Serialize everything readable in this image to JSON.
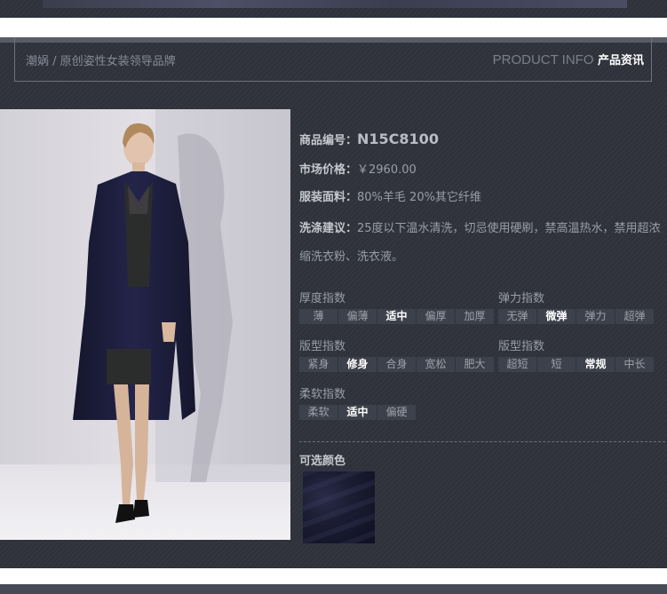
{
  "header": {
    "breadcrumb": "潮娲 / 原创姿性女装领导品牌",
    "section_en": "PRODUCT INFO",
    "section_cn": "产品资讯"
  },
  "product": {
    "code_label": "商品编号：",
    "code_value": "N15C8100",
    "price_label": "市场价格：",
    "price_value": "￥2960.00",
    "fabric_label": "服装面料：",
    "fabric_value": "80%羊毛 20%其它纤维",
    "care_label": "洗涤建议：",
    "care_value": "25度以下温水清洗，切忌使用硬刷，禁高温热水，禁用超浓缩洗衣粉、洗衣液。"
  },
  "indices": {
    "thickness": {
      "title": "厚度指数",
      "options": [
        "薄",
        "偏薄",
        "适中",
        "偏厚",
        "加厚"
      ],
      "selected": "适中"
    },
    "elasticity": {
      "title": "弹力指数",
      "options": [
        "无弹",
        "微弹",
        "弹力",
        "超弹"
      ],
      "selected": "微弹"
    },
    "fit": {
      "title": "版型指数",
      "options": [
        "紧身",
        "修身",
        "合身",
        "宽松",
        "肥大"
      ],
      "selected": "修身"
    },
    "length": {
      "title": "版型指数",
      "options": [
        "超短",
        "短",
        "常规",
        "中长"
      ],
      "selected": "常规"
    },
    "softness": {
      "title": "柔软指数",
      "options": [
        "柔软",
        "适中",
        "偏硬"
      ],
      "selected": "适中"
    }
  },
  "colors": {
    "label": "可选颜色",
    "swatch_color": "#1b1c33"
  },
  "theme": {
    "background": "#2f323b",
    "accent_white": "#ffffff",
    "coat_color": "#1c1d35"
  }
}
